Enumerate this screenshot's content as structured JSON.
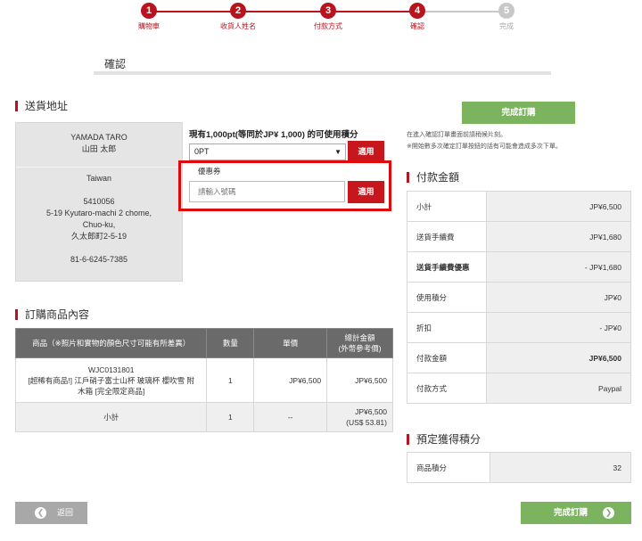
{
  "stepper": {
    "steps": [
      {
        "num": "1",
        "label": "購物車"
      },
      {
        "num": "2",
        "label": "收貨人姓名"
      },
      {
        "num": "3",
        "label": "付款方式"
      },
      {
        "num": "4",
        "label": "確認"
      },
      {
        "num": "5",
        "label": "完成"
      }
    ],
    "active_color": "#b8141f",
    "inactive_color": "#c8c8c8"
  },
  "page_title": "確認",
  "shipping": {
    "title": "送貨地址",
    "name_en": "YAMADA TARO",
    "name_jp": "山田 太郎",
    "country": "Taiwan",
    "postal": "5410056",
    "address1": "5-19 Kyutaro-machi 2 chome,",
    "address2": "Chuo-ku,",
    "address3": "久太郎町2-5-19",
    "phone": "81-6-6245-7385"
  },
  "points": {
    "text": "現有1,000pt(等同於JP¥ 1,000) 的可使用積分",
    "selected": "0PT",
    "apply_label": "適用"
  },
  "coupon": {
    "label": "優惠券",
    "placeholder": "請輸入號碼",
    "apply_label": "適用"
  },
  "order": {
    "title": "訂購商品內容",
    "headers": {
      "product": "商品（※照片和實物的顏色尺寸可能有所差異）",
      "qty": "數量",
      "unit": "單價",
      "total_line1": "總計金額",
      "total_line2": "(外幣參考價)"
    },
    "item": {
      "code": "WJC0131801",
      "name_line1": "[超稀有商品!] 江戶硝子富士山杯 玻璃杯 櫻吹雪 附",
      "name_line2": "木箱 [完全限定商品]",
      "qty": "1",
      "unit": "JP¥6,500",
      "total": "JP¥6,500"
    },
    "subtotal": {
      "label": "小計",
      "qty": "1",
      "unit": "--",
      "total_line1": "JP¥6,500",
      "total_line2": "(US$ 53.81)"
    }
  },
  "summary": {
    "finish_label": "完成訂購",
    "note1": "在進入確認訂單畫面前請稍候片刻。",
    "note2": "※開始數多次確定訂單按鈕的話有可能會造成多次下單。",
    "title": "付款金額",
    "rows": [
      {
        "label": "小計",
        "value": "JP¥6,500"
      },
      {
        "label": "送貨手續費",
        "value": "JP¥1,680"
      },
      {
        "label": "送貨手續費優惠",
        "value": "- JP¥1,680"
      },
      {
        "label": "使用積分",
        "value": "JP¥0"
      },
      {
        "label": "折扣",
        "value": "- JP¥0"
      },
      {
        "label": "付款金額",
        "value": "JP¥6,500"
      },
      {
        "label": "付款方式",
        "value": "Paypal"
      }
    ],
    "earn_title": "預定獲得積分",
    "earn_label": "商品積分",
    "earn_value": "32"
  },
  "footer": {
    "back_label": "返回",
    "finish_label": "完成訂購"
  },
  "colors": {
    "brand_red": "#b8141f",
    "button_green": "#7cb35f",
    "highlight_red": "#e00a0a"
  }
}
